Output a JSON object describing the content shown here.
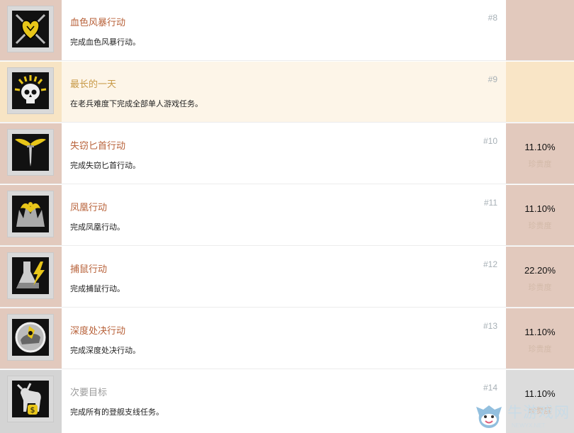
{
  "colors": {
    "left_default": "#e2c9bd",
    "left_highlight": "#f7e4c4",
    "left_gray": "#d4d4d4",
    "right_default": "#e2c9bd",
    "right_highlight": "#f9e5c6",
    "right_gray": "#dcdcdc",
    "mid_highlight": "#fdf5e8",
    "title_default": "#b8623a",
    "title_highlight": "#c89a48",
    "title_gray": "#9a9a9a"
  },
  "achievements": [
    {
      "icon": "heart-swords-icon",
      "title": "血色风暴行动",
      "desc": "完成血色风暴行动。",
      "number": "#8",
      "percent": "",
      "rarity_label": "",
      "style": "default"
    },
    {
      "icon": "skull-sun-icon",
      "title": "最长的一天",
      "desc": "在老兵难度下完成全部单人游戏任务。",
      "number": "#9",
      "percent": "",
      "rarity_label": "",
      "style": "highlight"
    },
    {
      "icon": "winged-dagger-icon",
      "title": "失窃匕首行动",
      "desc": "完成失窃匕首行动。",
      "number": "#10",
      "percent": "11.10%",
      "rarity_label": "珍贵度",
      "style": "default"
    },
    {
      "icon": "phoenix-icon",
      "title": "凤凰行动",
      "desc": "完成凤凰行动。",
      "number": "#11",
      "percent": "11.10%",
      "rarity_label": "珍贵度",
      "style": "default"
    },
    {
      "icon": "flask-lightning-icon",
      "title": "捕鼠行动",
      "desc": "完成捕鼠行动。",
      "number": "#12",
      "percent": "22.20%",
      "rarity_label": "珍贵度",
      "style": "default"
    },
    {
      "icon": "helmet-emblem-icon",
      "title": "深度处决行动",
      "desc": "完成深度处决行动。",
      "number": "#13",
      "percent": "11.10%",
      "rarity_label": "珍贵度",
      "style": "default"
    },
    {
      "icon": "goat-money-icon",
      "title": "次要目标",
      "desc": "完成所有的登舰支线任务。",
      "number": "#14",
      "percent": "11.10%",
      "rarity_label": "珍贵度",
      "style": "gray"
    }
  ],
  "watermark": {
    "text": "牛游戏网",
    "sub": "NEWYX.NET"
  }
}
